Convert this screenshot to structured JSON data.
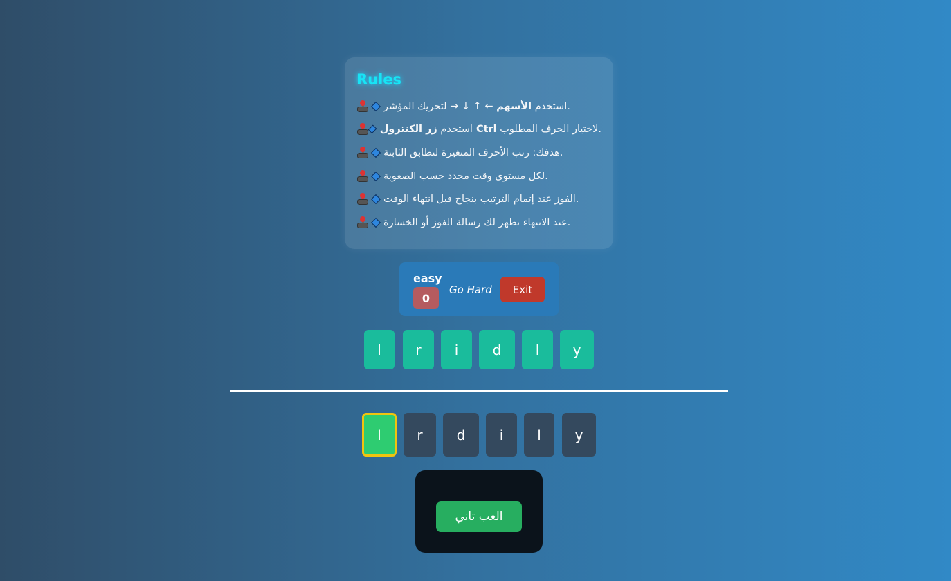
{
  "rules": {
    "title": "Rules",
    "items": [
      {
        "pre": "استخدم ",
        "bold": "الأسهم",
        "post": " ← ↑ ↓ → لتحريك المؤشر."
      },
      {
        "pre": "استخدم ",
        "bold": "زر الكنترول Ctrl",
        "post": " لاختيار الحرف المطلوب."
      },
      {
        "pre": "هدفك: رتب الأحرف المتغيرة لتطابق الثابتة.",
        "bold": "",
        "post": ""
      },
      {
        "pre": "لكل مستوى وقت محدد حسب الصعوبة.",
        "bold": "",
        "post": ""
      },
      {
        "pre": "الفوز عند إتمام الترتيب بنجاح قبل انتهاء الوقت.",
        "bold": "",
        "post": ""
      },
      {
        "pre": "عند الانتهاء تظهر لك رسالة الفوز أو الخسارة.",
        "bold": "",
        "post": ""
      }
    ]
  },
  "controls": {
    "level": "easy",
    "score": "0",
    "go_hard_label": "Go Hard",
    "exit_label": "Exit"
  },
  "target_letters": [
    "l",
    "r",
    "i",
    "d",
    "l",
    "y"
  ],
  "play_letters": [
    "l",
    "r",
    "d",
    "i",
    "l",
    "y"
  ],
  "selected_index": 0,
  "result": {
    "replay_label": "العب تاني"
  },
  "colors": {
    "target_tile": "#1abc9c",
    "play_tile": "#34495e",
    "selected_tile": "#2ecc71",
    "selected_border": "#f1c40f",
    "exit_button": "#c0392b",
    "replay_button": "#27ae60",
    "rules_title": "#18e4f5"
  }
}
